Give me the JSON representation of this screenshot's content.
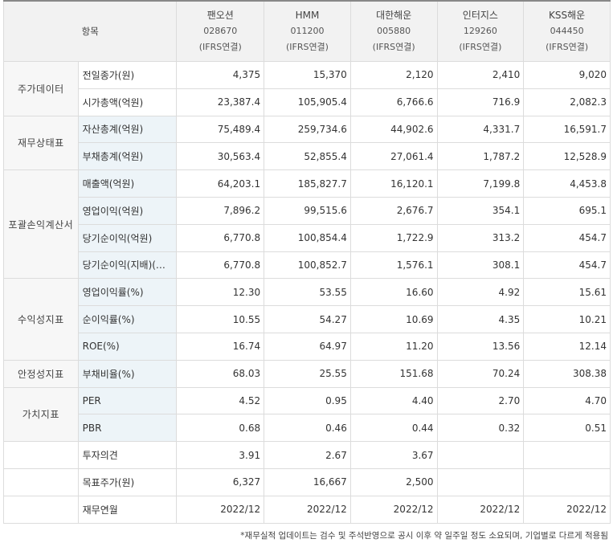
{
  "header": {
    "item_label": "항목",
    "companies": [
      {
        "name": "팬오션",
        "code": "028670",
        "std": "(IFRS연결)"
      },
      {
        "name": "HMM",
        "code": "011200",
        "std": "(IFRS연결)"
      },
      {
        "name": "대한해운",
        "code": "005880",
        "std": "(IFRS연결)"
      },
      {
        "name": "인터지스",
        "code": "129260",
        "std": "(IFRS연결)"
      },
      {
        "name": "KSS해운",
        "code": "044450",
        "std": "(IFRS연결)"
      }
    ]
  },
  "categories": {
    "stock": "주가데이터",
    "balance": "재무상태표",
    "income": "포괄손익계산서",
    "profitability": "수익성지표",
    "stability": "안정성지표",
    "value": "가치지표"
  },
  "rows": [
    {
      "label": "전일종가(원)",
      "values": [
        "4,375",
        "15,370",
        "2,120",
        "2,410",
        "9,020"
      ]
    },
    {
      "label": "시가총액(억원)",
      "values": [
        "23,387.4",
        "105,905.4",
        "6,766.6",
        "716.9",
        "2,082.3"
      ]
    },
    {
      "label": "자산총계(억원)",
      "values": [
        "75,489.4",
        "259,734.6",
        "44,902.6",
        "4,331.7",
        "16,591.7"
      ]
    },
    {
      "label": "부채총계(억원)",
      "values": [
        "30,563.4",
        "52,855.4",
        "27,061.4",
        "1,787.2",
        "12,528.9"
      ]
    },
    {
      "label": "매출액(억원)",
      "values": [
        "64,203.1",
        "185,827.7",
        "16,120.1",
        "7,199.8",
        "4,453.8"
      ]
    },
    {
      "label": "영업이익(억원)",
      "values": [
        "7,896.2",
        "99,515.6",
        "2,676.7",
        "354.1",
        "695.1"
      ]
    },
    {
      "label": "당기순이익(억원)",
      "values": [
        "6,770.8",
        "100,854.4",
        "1,722.9",
        "313.2",
        "454.7"
      ]
    },
    {
      "label": "당기순이익(지배)(…",
      "values": [
        "6,770.8",
        "100,852.7",
        "1,576.1",
        "308.1",
        "454.7"
      ]
    },
    {
      "label": "영업이익률(%)",
      "values": [
        "12.30",
        "53.55",
        "16.60",
        "4.92",
        "15.61"
      ]
    },
    {
      "label": "순이익률(%)",
      "values": [
        "10.55",
        "54.27",
        "10.69",
        "4.35",
        "10.21"
      ]
    },
    {
      "label": "ROE(%)",
      "values": [
        "16.74",
        "64.97",
        "11.20",
        "13.56",
        "12.14"
      ]
    },
    {
      "label": "부채비율(%)",
      "values": [
        "68.03",
        "25.55",
        "151.68",
        "70.24",
        "308.38"
      ]
    },
    {
      "label": "PER",
      "values": [
        "4.52",
        "0.95",
        "4.40",
        "2.70",
        "4.70"
      ]
    },
    {
      "label": "PBR",
      "values": [
        "0.68",
        "0.46",
        "0.44",
        "0.32",
        "0.51"
      ]
    },
    {
      "label": "투자의견",
      "values": [
        "3.91",
        "2.67",
        "3.67",
        "",
        ""
      ]
    },
    {
      "label": "목표주가(원)",
      "values": [
        "6,327",
        "16,667",
        "2,500",
        "",
        ""
      ]
    },
    {
      "label": "재무연월",
      "values": [
        "2022/12",
        "2022/12",
        "2022/12",
        "2022/12",
        "2022/12"
      ]
    }
  ],
  "footnote": "*재무실적 업데이트는 검수 및 주석반영으로 공시 이후 약 일주일 정도 소요되며, 기업별로 다르게 적용됨"
}
